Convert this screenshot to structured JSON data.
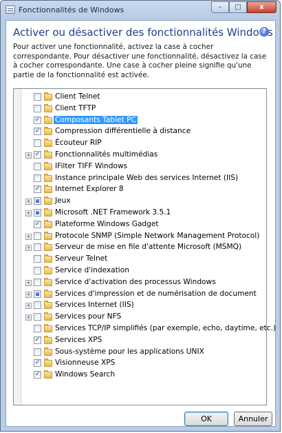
{
  "window": {
    "title": "Fonctionnalités de Windows",
    "controls": {
      "minimize": "–",
      "maximize": "□",
      "close": "x"
    }
  },
  "heading": "Activer ou désactiver des fonctionnalités Windows",
  "help_icon": "?",
  "description": "Pour activer une fonctionnalité, activez la case à cocher correspondante. Pour désactiver une fonctionnalité, désactivez la case à cocher correspondante. Une case à cocher pleine signifie qu'une partie de la fonctionnalité est activée.",
  "features": [
    {
      "label": "Client Telnet",
      "state": "unchecked",
      "expandable": false,
      "selected": false
    },
    {
      "label": "Client TFTP",
      "state": "unchecked",
      "expandable": false,
      "selected": false
    },
    {
      "label": "Composants Tablet PC",
      "state": "checked",
      "expandable": false,
      "selected": true
    },
    {
      "label": "Compression différentielle à distance",
      "state": "checked",
      "expandable": false,
      "selected": false
    },
    {
      "label": "Écouteur RIP",
      "state": "unchecked",
      "expandable": false,
      "selected": false
    },
    {
      "label": "Fonctionnalités multimédias",
      "state": "checked",
      "expandable": true,
      "selected": false
    },
    {
      "label": "IFilter TIFF Windows",
      "state": "unchecked",
      "expandable": false,
      "selected": false
    },
    {
      "label": "Instance principale Web des services Internet (IIS)",
      "state": "unchecked",
      "expandable": false,
      "selected": false
    },
    {
      "label": "Internet Explorer 8",
      "state": "checked",
      "expandable": false,
      "selected": false
    },
    {
      "label": "Jeux",
      "state": "partial",
      "expandable": true,
      "selected": false
    },
    {
      "label": "Microsoft .NET Framework 3.5.1",
      "state": "partial",
      "expandable": true,
      "selected": false
    },
    {
      "label": "Plateforme Windows Gadget",
      "state": "checked",
      "expandable": false,
      "selected": false
    },
    {
      "label": "Protocole SNMP (Simple Network Management Protocol)",
      "state": "unchecked",
      "expandable": true,
      "selected": false
    },
    {
      "label": "Serveur de mise en file d'attente Microsoft (MSMQ)",
      "state": "unchecked",
      "expandable": true,
      "selected": false
    },
    {
      "label": "Serveur Telnet",
      "state": "unchecked",
      "expandable": false,
      "selected": false
    },
    {
      "label": "Service d'indexation",
      "state": "unchecked",
      "expandable": false,
      "selected": false
    },
    {
      "label": "Service d'activation des processus Windows",
      "state": "unchecked",
      "expandable": true,
      "selected": false
    },
    {
      "label": "Services d'impression et de numérisation de document",
      "state": "partial",
      "expandable": true,
      "selected": false
    },
    {
      "label": "Services Internet (IIS)",
      "state": "unchecked",
      "expandable": true,
      "selected": false
    },
    {
      "label": "Services pour NFS",
      "state": "unchecked",
      "expandable": true,
      "selected": false
    },
    {
      "label": "Services TCP/IP simplifiés (par exemple, echo, daytime, etc.)",
      "state": "unchecked",
      "expandable": false,
      "selected": false
    },
    {
      "label": "Services XPS",
      "state": "checked",
      "expandable": false,
      "selected": false
    },
    {
      "label": "Sous-système pour les applications UNIX",
      "state": "unchecked",
      "expandable": false,
      "selected": false
    },
    {
      "label": "Visionneuse XPS",
      "state": "checked",
      "expandable": false,
      "selected": false
    },
    {
      "label": "Windows Search",
      "state": "checked",
      "expandable": false,
      "selected": false
    }
  ],
  "buttons": {
    "ok": "OK",
    "cancel": "Annuler"
  },
  "colors": {
    "heading": "#1e3d8e",
    "selection": "#3399ff",
    "close_button": "#c7422c"
  }
}
